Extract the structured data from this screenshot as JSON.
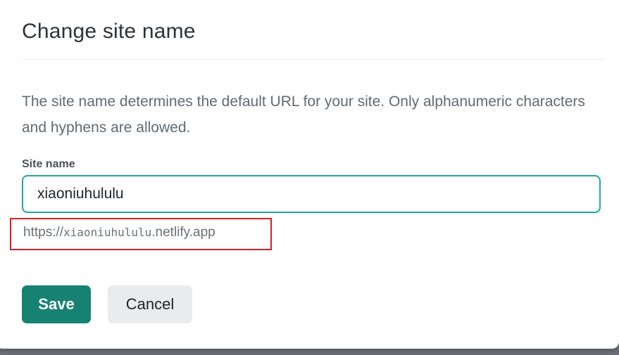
{
  "dialog": {
    "title": "Change site name",
    "description": "The site name determines the default URL for your site. Only alphanumeric characters and hyphens are allowed.",
    "field": {
      "label": "Site name",
      "value": "xiaoniuhululu"
    },
    "url_preview": {
      "prefix": "https://",
      "site": "xiaoniuhululu",
      "suffix": ".netlify.app"
    },
    "buttons": {
      "save_label": "Save",
      "cancel_label": "Cancel"
    }
  },
  "colors": {
    "accent_border": "#1fa8a1",
    "save_button": "#168272",
    "highlight_annotation": "#d42128"
  }
}
